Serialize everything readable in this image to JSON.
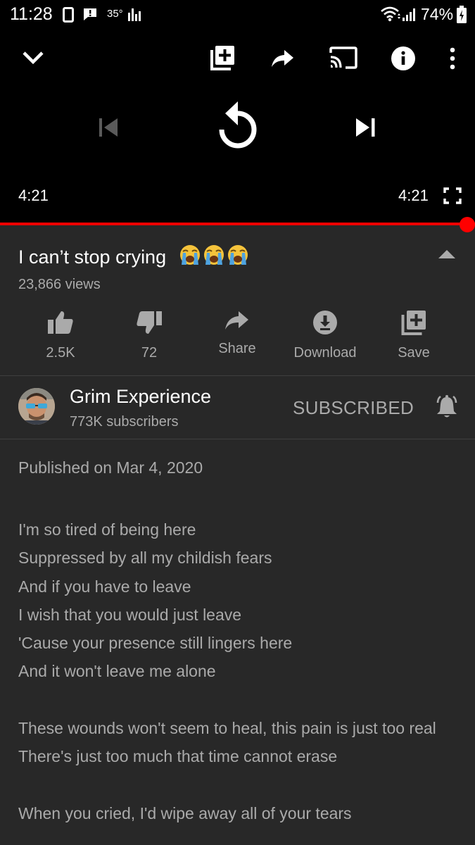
{
  "status_bar": {
    "time": "11:28",
    "temperature": "35°",
    "battery": "74%"
  },
  "player": {
    "current_time": "4:21",
    "duration": "4:21",
    "progress": 1.0,
    "accent_color": "#ff0000"
  },
  "video": {
    "title": "I can’t stop crying",
    "title_emoji_count": 3,
    "views": "23,866 views"
  },
  "actions": [
    {
      "icon": "thumbs-up-icon",
      "label": "2.5K"
    },
    {
      "icon": "thumbs-down-icon",
      "label": "72"
    },
    {
      "icon": "share-icon",
      "label": "Share"
    },
    {
      "icon": "download-icon",
      "label": "Download"
    },
    {
      "icon": "save-icon",
      "label": "Save"
    }
  ],
  "channel": {
    "name": "Grim Experience",
    "subscribers": "773K subscribers",
    "subscribe_state": "SUBSCRIBED"
  },
  "description": {
    "published": "Published on Mar 4, 2020",
    "lines": [
      "I'm so tired of being here",
      "Suppressed by all my childish fears",
      "And if you have to leave",
      "I wish that you would just leave",
      "'Cause your presence still lingers here",
      "And it won't leave me alone",
      "",
      "These wounds won't seem to heal, this pain is just too real",
      "There's just too much that time cannot erase",
      "",
      "When you cried, I'd wipe away all of your tears"
    ]
  },
  "colors": {
    "background": "#282828",
    "player_background": "#000000",
    "secondary_text": "#aaaaaa"
  }
}
